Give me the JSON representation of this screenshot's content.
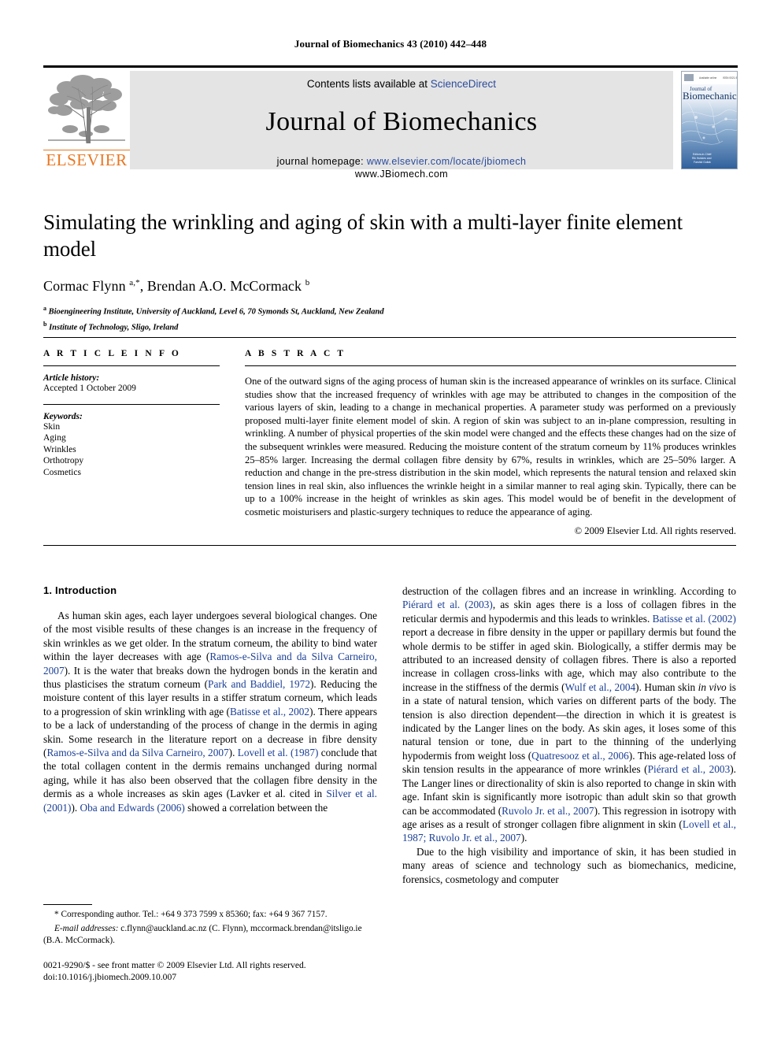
{
  "running_head": "Journal of Biomechanics 43 (2010) 442–448",
  "masthead": {
    "publisher_logo_label": "ELSEVIER",
    "contents_prefix": "Contents lists available at",
    "contents_link": "ScienceDirect",
    "journal_title": "Journal of Biomechanics",
    "homepage_prefix": "journal homepage:",
    "homepage_url": "www.elsevier.com/locate/jbiomech",
    "homepage_url2": "www.JBiomech.com",
    "cover_title_top": "Journal of",
    "cover_title_main": "Biomechanics",
    "cover_issn": "ISSN 0021-9290",
    "cover_footer_1": "Editors-in-Chief:",
    "cover_footer_2": "Rik Huiskes and",
    "cover_footer_3": "Farshid Guilak"
  },
  "article": {
    "title": "Simulating the wrinkling and aging of skin with a multi-layer finite element model",
    "authors_html": "Cormac Flynn <sup>a,*</sup>, Brendan A.O. McCormack <sup>b</sup>",
    "affiliation_a": "Bioengineering Institute, University of Auckland, Level 6, 70 Symonds St, Auckland, New Zealand",
    "affiliation_b": "Institute of Technology, Sligo, Ireland"
  },
  "article_info": {
    "heading": "A R T I C L E   I N F O",
    "history_label": "Article history:",
    "history_items": [
      "Accepted 1 October 2009"
    ],
    "keywords_label": "Keywords:",
    "keywords": [
      "Skin",
      "Aging",
      "Wrinkles",
      "Orthotropy",
      "Cosmetics"
    ]
  },
  "abstract": {
    "heading": "A B S T R A C T",
    "text": "One of the outward signs of the aging process of human skin is the increased appearance of wrinkles on its surface. Clinical studies show that the increased frequency of wrinkles with age may be attributed to changes in the composition of the various layers of skin, leading to a change in mechanical properties. A parameter study was performed on a previously proposed multi-layer finite element model of skin. A region of skin was subject to an in-plane compression, resulting in wrinkling. A number of physical properties of the skin model were changed and the effects these changes had on the size of the subsequent wrinkles were measured. Reducing the moisture content of the stratum corneum by 11% produces wrinkles 25–85% larger. Increasing the dermal collagen fibre density by 67%, results in wrinkles, which are 25–50% larger. A reduction and change in the pre-stress distribution in the skin model, which represents the natural tension and relaxed skin tension lines in real skin, also influences the wrinkle height in a similar manner to real aging skin. Typically, there can be up to a 100% increase in the height of wrinkles as skin ages. This model would be of benefit in the development of cosmetic moisturisers and plastic-surgery techniques to reduce the appearance of aging.",
    "copyright": "© 2009 Elsevier Ltd. All rights reserved."
  },
  "body": {
    "section_heading": "1.  Introduction",
    "left_paragraph_html": "As human skin ages, each layer undergoes several biological changes. One of the most visible results of these changes is an increase in the frequency of skin wrinkles as we get older. In the stratum corneum, the ability to bind water within the layer decreases with age (<span class=\"cite\">Ramos-e-Silva and da Silva Carneiro, 2007</span>). It is the water that breaks down the hydrogen bonds in the keratin and thus plasticises the stratum corneum (<span class=\"cite\">Park and Baddiel, 1972</span>). Reducing the moisture content of this layer results in a stiffer stratum corneum, which leads to a progression of skin wrinkling with age (<span class=\"cite\">Batisse et al., 2002</span>). There appears to be a lack of understanding of the process of change in the dermis in aging skin. Some research in the literature report on a decrease in fibre density (<span class=\"cite\">Ramos-e-Silva and da Silva Carneiro, 2007</span>). <span class=\"cite\">Lovell et al. (1987)</span> conclude that the total collagen content in the dermis remains unchanged during normal aging, while it has also been observed that the collagen fibre density in the dermis as a whole increases as skin ages (Lavker et al. cited in <span class=\"cite\">Silver et al. (2001)</span>). <span class=\"cite\">Oba and Edwards (2006)</span> showed a correlation between the",
    "right_paragraph_1_html": "destruction of the collagen fibres and an increase in wrinkling. According to <span class=\"cite\">Piérard et al. (2003)</span>, as skin ages there is a loss of collagen fibres in the reticular dermis and hypodermis and this leads to wrinkles. <span class=\"cite\">Batisse et al. (2002)</span> report a decrease in fibre density in the upper or papillary dermis but found the whole dermis to be stiffer in aged skin. Biologically, a stiffer dermis may be attributed to an increased density of collagen fibres. There is also a reported increase in collagen cross-links with age, which may also contribute to the increase in the stiffness of the dermis (<span class=\"cite\">Wulf et al., 2004</span>). Human skin <i>in vivo</i> is in a state of natural tension, which varies on different parts of the body. The tension is also direction dependent—the direction in which it is greatest is indicated by the Langer lines on the body. As skin ages, it loses some of this natural tension or tone, due in part to the thinning of the underlying hypodermis from weight loss (<span class=\"cite\">Quatresooz et al., 2006</span>). This age-related loss of skin tension results in the appearance of more wrinkles (<span class=\"cite\">Piérard et al., 2003</span>). The Langer lines or directionality of skin is also reported to change in skin with age. Infant skin is significantly more isotropic than adult skin so that growth can be accommodated (<span class=\"cite\">Ruvolo Jr. et al., 2007</span>). This regression in isotropy with age arises as a result of stronger collagen fibre alignment in skin (<span class=\"cite\">Lovell et al., 1987; Ruvolo Jr. et al., 2007</span>).",
    "right_paragraph_2_html": "Due to the high visibility and importance of skin, it has been studied in many areas of science and technology such as biomechanics, medicine, forensics, cosmetology and computer"
  },
  "footnote": {
    "corresponding_html": "* Corresponding author. Tel.: +64 9 373 7599 x 85360; fax: +64 9 367 7157.",
    "email_html": "<span class=\"ital\">E-mail addresses:</span> c.flynn@auckland.ac.nz (C. Flynn), mccormack.brendan@itsligo.ie (B.A. McCormack)."
  },
  "imprint": {
    "line1": "0021-9290/$ - see front matter © 2009 Elsevier Ltd. All rights reserved.",
    "line2": "doi:10.1016/j.jbiomech.2009.10.007"
  },
  "colors": {
    "link_blue": "#2b4b9b",
    "citation_blue": "#1c3f94",
    "elsevier_orange": "#E87722",
    "masthead_gray": "#e4e4e4"
  }
}
